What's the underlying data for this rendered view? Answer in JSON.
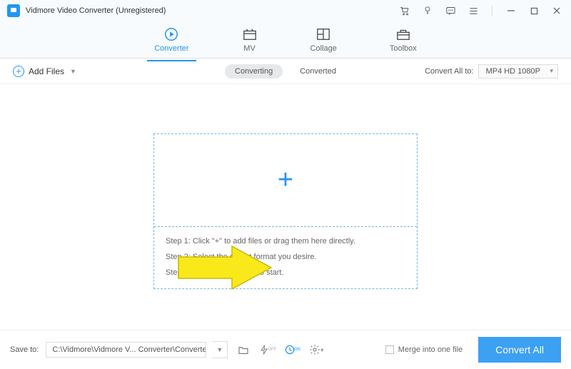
{
  "titlebar": {
    "title": "Vidmore Video Converter (Unregistered)"
  },
  "nav": {
    "converter": "Converter",
    "mv": "MV",
    "collage": "Collage",
    "toolbox": "Toolbox"
  },
  "subbar": {
    "add_files": "Add Files",
    "converting": "Converting",
    "converted": "Converted",
    "convert_all_to": "Convert All to:",
    "format_selected": "MP4 HD 1080P"
  },
  "steps": {
    "s1": "Step 1: Click \"+\" to add files or drag them here directly.",
    "s2": "Step 2: Select the output format you desire.",
    "s3": "Step 3: Click \"Convert All\" to start."
  },
  "footer": {
    "save_to": "Save to:",
    "path": "C:\\Vidmore\\Vidmore V... Converter\\Converted",
    "merge": "Merge into one file",
    "convert_all": "Convert All"
  }
}
